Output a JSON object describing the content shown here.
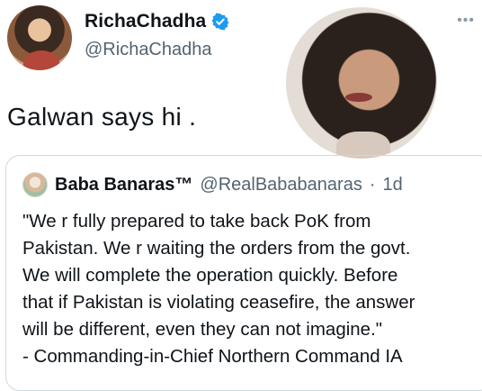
{
  "author": {
    "display_name": "RichaChadha",
    "handle": "@RichaChadha",
    "verified_icon": "verified-badge-icon",
    "verified_color": "#1d9bf0"
  },
  "menu": {
    "more_label": "•••"
  },
  "tweet": {
    "text": "Galwan says hi ."
  },
  "quoted_tweet": {
    "display_name": "Baba Banaras™",
    "handle": "@RealBababanaras",
    "separator": "·",
    "time": "1d",
    "lines": [
      "\"We r fully prepared to take back PoK from",
      "Pakistan. We r waiting the orders from the govt.",
      "We will complete the operation quickly. Before",
      "that if Pakistan is violating ceasefire, the answer",
      "will be different, even they can not imagine.\"",
      "- Commanding-in-Chief Northern Command IA"
    ]
  },
  "colors": {
    "text": "#0f1419",
    "secondary": "#536471",
    "border": "#cfd9de"
  }
}
